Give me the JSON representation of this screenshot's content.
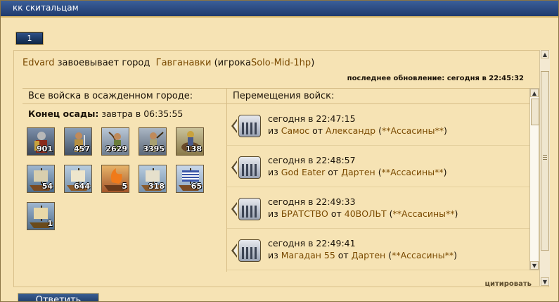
{
  "window": {
    "title": "кк скитальцам"
  },
  "pagination": {
    "current_page": "1"
  },
  "headline": {
    "player": "Edvard",
    "action": "завоевывает город",
    "city": "Гавганавки",
    "owner_prefix": "(игрока",
    "owner": "Solo-Mid-1hp",
    "owner_suffix": ")",
    "last_update": "последнее обновление: сегодня в 22:45:32"
  },
  "left_column": {
    "header": "Все войска в осажденном городе:",
    "siege_label": "Конец осады:",
    "siege_end": "завтра в 06:35:55",
    "units": [
      {
        "icon": "hoplite-icon",
        "count": "901"
      },
      {
        "icon": "swordsman-icon",
        "count": "457"
      },
      {
        "icon": "archer-icon",
        "count": "2629"
      },
      {
        "icon": "slinger-icon",
        "count": "3395"
      },
      {
        "icon": "horseman-icon",
        "count": "138"
      },
      {
        "icon": "transport-ship-icon",
        "count": "54"
      },
      {
        "icon": "bireme-icon",
        "count": "644"
      },
      {
        "icon": "fire-ship-icon",
        "count": "5"
      },
      {
        "icon": "trireme-icon",
        "count": "318"
      },
      {
        "icon": "fast-transport-icon",
        "count": "65"
      },
      {
        "icon": "colony-ship-icon",
        "count": "1"
      }
    ]
  },
  "right_column": {
    "header": "Перемещения войск:",
    "movements": [
      {
        "time": "сегодня в 22:47:15",
        "from_prefix": "из",
        "from_city": "Самос",
        "by_prefix": "от",
        "player": "Александр",
        "alliance": "**Ассасины**"
      },
      {
        "time": "сегодня в 22:48:57",
        "from_prefix": "из",
        "from_city": "God Eater",
        "by_prefix": "от",
        "player": "Дартен",
        "alliance": "**Ассасины**"
      },
      {
        "time": "сегодня в 22:49:33",
        "from_prefix": "из",
        "from_city": "БРАТСТВО",
        "by_prefix": "от",
        "player": "40ВОЛЬТ",
        "alliance": "**Ассасины**"
      },
      {
        "time": "сегодня в 22:49:41",
        "from_prefix": "из",
        "from_city": "Магадан 55",
        "by_prefix": "от",
        "player": "Дартен",
        "alliance": "**Ассасины**"
      }
    ]
  },
  "actions": {
    "quote": "цитировать",
    "reply": "Ответить"
  },
  "colors": {
    "title_bar": "#1f3a6c",
    "parchment": "#f6e3b4",
    "link_brown": "#7a4a00"
  }
}
